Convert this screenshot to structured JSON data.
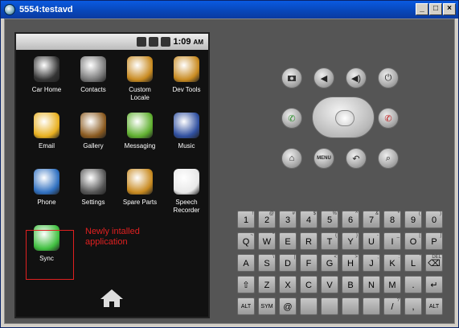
{
  "window": {
    "title": "5554:testavd",
    "min": "_",
    "max": "□",
    "close": "×"
  },
  "status": {
    "time": "1:09",
    "ampm": "AM"
  },
  "apps": [
    {
      "label": "Car Home",
      "icon": "car-home-icon",
      "color": "#333"
    },
    {
      "label": "Contacts",
      "icon": "contacts-icon",
      "color": "#777"
    },
    {
      "label": "Custom\nLocale",
      "icon": "gear-icon",
      "color": "#c88a20"
    },
    {
      "label": "Dev Tools",
      "icon": "gear-icon",
      "color": "#c88a20"
    },
    {
      "label": "Email",
      "icon": "email-icon",
      "color": "#e8b020"
    },
    {
      "label": "Gallery",
      "icon": "gallery-icon",
      "color": "#8a5a20"
    },
    {
      "label": "Messaging",
      "icon": "messaging-icon",
      "color": "#60b030"
    },
    {
      "label": "Music",
      "icon": "music-icon",
      "color": "#3050a0"
    },
    {
      "label": "Phone",
      "icon": "phone-icon",
      "color": "#3070c0"
    },
    {
      "label": "Settings",
      "icon": "settings-icon",
      "color": "#555"
    },
    {
      "label": "Spare Parts",
      "icon": "gear-icon",
      "color": "#c88a20"
    },
    {
      "label": "Speech\nRecorder",
      "icon": "speech-recorder-icon",
      "color": "#e8e8e8"
    },
    {
      "label": "Sync",
      "icon": "sync-icon",
      "color": "#40c040"
    }
  ],
  "annotation": "Newly intalled\napplication",
  "keyboard": {
    "rows": [
      [
        [
          "1",
          "!"
        ],
        [
          "2",
          "@"
        ],
        [
          "3",
          "#"
        ],
        [
          "4",
          "$"
        ],
        [
          "5",
          "%"
        ],
        [
          "6",
          "^"
        ],
        [
          "7",
          "&"
        ],
        [
          "8",
          "*"
        ],
        [
          "9",
          "("
        ],
        [
          "0",
          ")"
        ]
      ],
      [
        [
          "Q",
          "~"
        ],
        [
          "W",
          "\""
        ],
        [
          "E",
          ""
        ],
        [
          "R",
          ""
        ],
        [
          "T",
          "{"
        ],
        [
          "Y",
          "}"
        ],
        [
          "U",
          "-"
        ],
        [
          "I",
          "_"
        ],
        [
          "O",
          "["
        ],
        [
          "P",
          "]"
        ]
      ],
      [
        [
          "A",
          ""
        ],
        [
          "S",
          "\\"
        ],
        [
          "D",
          "|"
        ],
        [
          "F",
          ""
        ],
        [
          "G",
          "<"
        ],
        [
          "H",
          ">"
        ],
        [
          "J",
          ";"
        ],
        [
          "K",
          ":"
        ],
        [
          "L",
          "'"
        ],
        [
          "⌫",
          "DEL"
        ]
      ],
      [
        [
          "⇧",
          ""
        ],
        [
          "Z",
          ""
        ],
        [
          "X",
          ""
        ],
        [
          "C",
          ""
        ],
        [
          "V",
          ""
        ],
        [
          "B",
          ""
        ],
        [
          "N",
          ""
        ],
        [
          "M",
          ""
        ],
        [
          ".",
          ""
        ],
        [
          "↵",
          ""
        ]
      ],
      [
        [
          "ALT",
          ""
        ],
        [
          "SYM",
          ""
        ],
        [
          "@",
          ""
        ],
        [
          "",
          ""
        ],
        [
          "",
          ""
        ],
        [
          "",
          ""
        ],
        [
          "",
          ""
        ],
        [
          "/",
          "?"
        ],
        [
          ",",
          ""
        ],
        [
          "ALT",
          ""
        ]
      ]
    ]
  },
  "controls": {
    "menu": "MENU"
  }
}
